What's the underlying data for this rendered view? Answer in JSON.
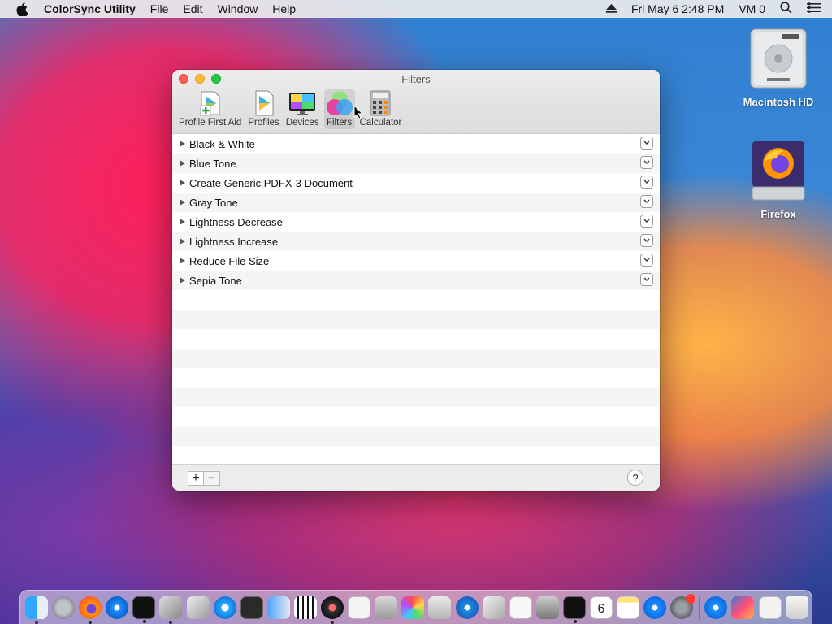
{
  "menubar": {
    "app_name": "ColorSync Utility",
    "menus": [
      "File",
      "Edit",
      "Window",
      "Help"
    ],
    "clock": "Fri May 6  2:48 PM",
    "user": "VM 0"
  },
  "desktop": {
    "icons": [
      {
        "label": "Macintosh HD",
        "icon": "hard-drive-icon"
      },
      {
        "label": "Firefox",
        "icon": "firefox-disk-icon"
      }
    ]
  },
  "window": {
    "title": "Filters",
    "toolbar": [
      {
        "label": "Profile First Aid",
        "icon": "profile-first-aid-icon"
      },
      {
        "label": "Profiles",
        "icon": "profiles-icon"
      },
      {
        "label": "Devices",
        "icon": "devices-icon"
      },
      {
        "label": "Filters",
        "icon": "filters-icon",
        "active": true
      },
      {
        "label": "Calculator",
        "icon": "calculator-icon"
      }
    ],
    "filters": [
      "Black & White",
      "Blue Tone",
      "Create Generic PDFX-3 Document",
      "Gray Tone",
      "Lightness Decrease",
      "Lightness Increase",
      "Reduce File Size",
      "Sepia Tone"
    ],
    "footer": {
      "add": "+",
      "remove": "−",
      "help": "?"
    }
  },
  "dock": {
    "calendar_day": "6",
    "notification_badge": "1"
  }
}
